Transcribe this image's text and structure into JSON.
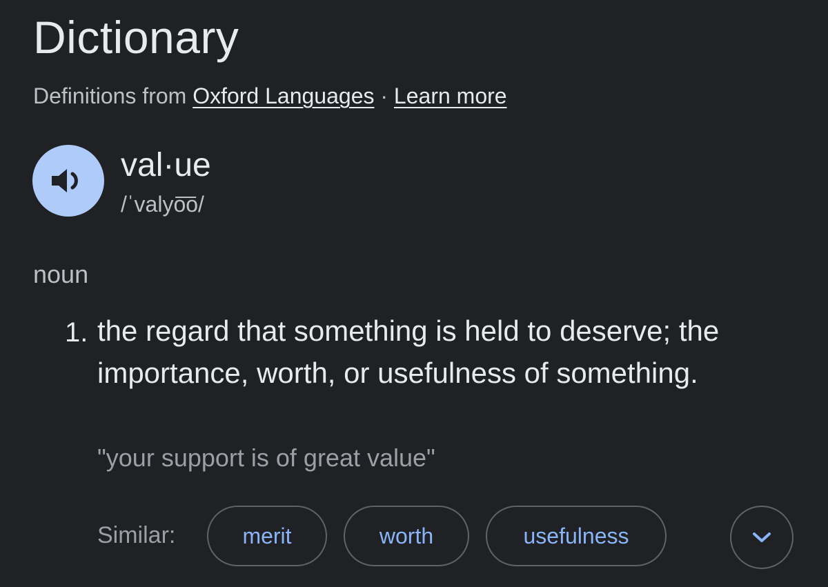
{
  "header": {
    "title": "Dictionary",
    "source_prefix": "Definitions from",
    "source_link": "Oxford Languages",
    "separator": "·",
    "learn_more": "Learn more"
  },
  "entry": {
    "audio_icon": "speaker-icon",
    "headword": "val·ue",
    "phonetic": "/ˈvalyo͞o/",
    "part_of_speech": "noun",
    "definitions": [
      {
        "number": "1.",
        "text": "the regard that something is held to deserve; the importance, worth, or usefulness of something.",
        "example": "\"your support is of great value\""
      }
    ]
  },
  "similar": {
    "label": "Similar:",
    "words": [
      "merit",
      "worth",
      "usefulness"
    ],
    "expand_icon": "chevron-down-icon"
  },
  "colors": {
    "background": "#202124",
    "audio_button": "#aecbfa",
    "chip_text": "#8ab4f8",
    "chip_border": "#5f6368"
  }
}
